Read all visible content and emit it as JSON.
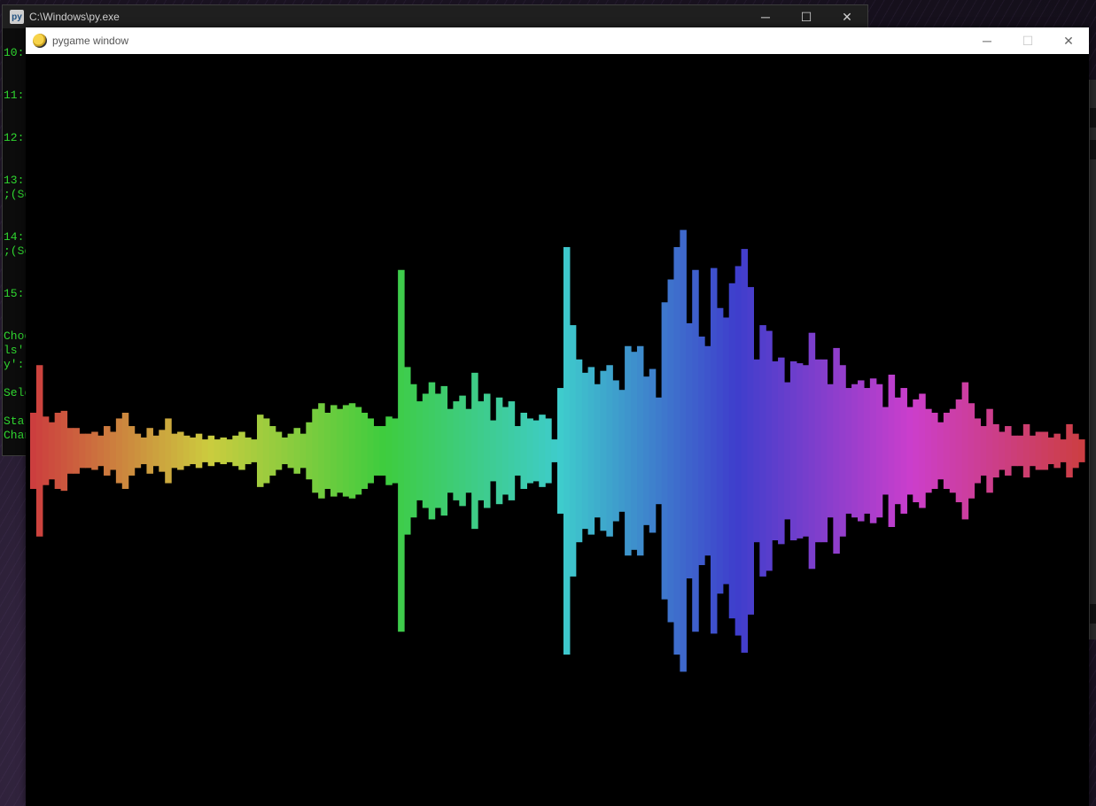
{
  "console": {
    "title": "C:\\Windows\\py.exe",
    "icon": "python-console-icon",
    "lines": [
      "10:",
      "11:",
      "12:",
      "13:",
      ";(Sc",
      "14:",
      ";(Sc",
      "15:",
      "Choo",
      "ls'",
      "y':",
      "Sele",
      "Star",
      "Chan"
    ],
    "text_color": "#2fd62f"
  },
  "pygame": {
    "title": "pygame window",
    "icon": "pygame-snake-icon",
    "controls": {
      "minimize": "─",
      "maximize": "☐",
      "close": "✕"
    }
  },
  "console_controls": {
    "minimize": "─",
    "maximize": "☐",
    "close": "✕"
  },
  "visualizer": {
    "background": "#000000",
    "bar_count": 170,
    "color_cycle": "hue sweep red → orange → yellow → green → cyan → blue → violet → magenta → red",
    "amplitudes": [
      0.2,
      0.45,
      0.18,
      0.15,
      0.2,
      0.21,
      0.12,
      0.12,
      0.09,
      0.09,
      0.1,
      0.08,
      0.13,
      0.1,
      0.17,
      0.2,
      0.13,
      0.09,
      0.07,
      0.12,
      0.08,
      0.11,
      0.17,
      0.09,
      0.1,
      0.08,
      0.07,
      0.09,
      0.06,
      0.08,
      0.06,
      0.07,
      0.06,
      0.08,
      0.1,
      0.07,
      0.06,
      0.19,
      0.17,
      0.13,
      0.1,
      0.07,
      0.09,
      0.12,
      0.09,
      0.15,
      0.22,
      0.25,
      0.2,
      0.24,
      0.22,
      0.24,
      0.25,
      0.23,
      0.2,
      0.17,
      0.13,
      0.13,
      0.18,
      0.17,
      0.95,
      0.44,
      0.35,
      0.26,
      0.3,
      0.36,
      0.3,
      0.34,
      0.22,
      0.26,
      0.29,
      0.22,
      0.41,
      0.26,
      0.3,
      0.16,
      0.28,
      0.23,
      0.26,
      0.13,
      0.2,
      0.17,
      0.16,
      0.19,
      0.17,
      0.06,
      0.33,
      1.07,
      0.66,
      0.48,
      0.41,
      0.44,
      0.35,
      0.42,
      0.45,
      0.37,
      0.32,
      0.55,
      0.52,
      0.55,
      0.39,
      0.43,
      0.28,
      0.78,
      0.9,
      1.07,
      1.16,
      0.67,
      0.95,
      0.6,
      0.55,
      0.96,
      0.75,
      0.7,
      0.88,
      0.97,
      1.06,
      0.86,
      0.48,
      0.66,
      0.63,
      0.47,
      0.49,
      0.36,
      0.47,
      0.46,
      0.45,
      0.62,
      0.48,
      0.48,
      0.35,
      0.54,
      0.45,
      0.33,
      0.35,
      0.37,
      0.33,
      0.38,
      0.35,
      0.23,
      0.4,
      0.28,
      0.33,
      0.23,
      0.27,
      0.3,
      0.22,
      0.2,
      0.15,
      0.2,
      0.22,
      0.27,
      0.36,
      0.25,
      0.17,
      0.13,
      0.22,
      0.14,
      0.1,
      0.13,
      0.08,
      0.08,
      0.14,
      0.08,
      0.1,
      0.1,
      0.07,
      0.09,
      0.06,
      0.14,
      0.09,
      0.06
    ],
    "accent_colors": [
      "#d04a4a",
      "#d9a04a",
      "#c8c83c",
      "#3cc83c",
      "#3cc8c8",
      "#4a4ad0",
      "#b84ad0",
      "#d04a6a"
    ]
  }
}
